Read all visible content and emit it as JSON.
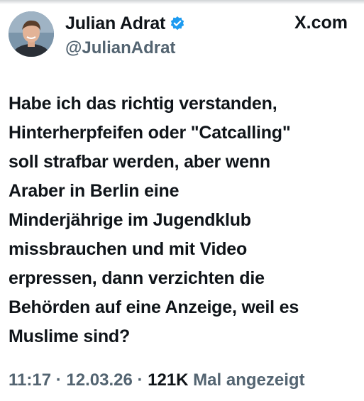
{
  "author": {
    "display_name": "Julian Adrat",
    "handle": "@JulianAdrat",
    "verified": true
  },
  "source_label": "X.com",
  "tweet": {
    "text": "Habe ich das richtig verstanden,\nHinterherpfeifen oder \"Catcalling\"\nsoll strafbar werden, aber wenn\nAraber in Berlin eine\nMinderjährige im Jugendklub\nmissbrauchen und mit Video\nerpressen, dann verzichten die\nBehörden auf eine Anzeige, weil es\nMuslime sind?"
  },
  "meta": {
    "time": "11:17",
    "separator": " · ",
    "date": "12.03.26",
    "views_count": "121K",
    "views_label": " Mal angezeigt"
  },
  "colors": {
    "text_primary": "#0f1419",
    "text_secondary": "#536471",
    "verified_blue": "#1d9bf0"
  },
  "icons": {
    "verified": "verified-badge-icon",
    "avatar": "profile-avatar"
  }
}
